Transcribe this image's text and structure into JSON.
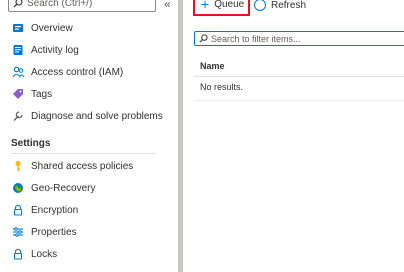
{
  "sidebar": {
    "search_placeholder": "Search (Ctrl+/)",
    "collapse_glyph": "«",
    "items": [
      {
        "label": "Overview",
        "icon": "overview-icon"
      },
      {
        "label": "Activity log",
        "icon": "activity-log-icon"
      },
      {
        "label": "Access control (IAM)",
        "icon": "people-icon"
      },
      {
        "label": "Tags",
        "icon": "tag-icon"
      },
      {
        "label": "Diagnose and solve problems",
        "icon": "wrench-icon"
      }
    ],
    "settings_header": "Settings",
    "settings_items": [
      {
        "label": "Shared access policies",
        "icon": "key-icon"
      },
      {
        "label": "Geo-Recovery",
        "icon": "globe-icon"
      },
      {
        "label": "Encryption",
        "icon": "lock-icon"
      },
      {
        "label": "Properties",
        "icon": "properties-icon"
      },
      {
        "label": "Locks",
        "icon": "lock-icon"
      }
    ]
  },
  "toolbar": {
    "queue_label": "Queue",
    "refresh_label": "Refresh"
  },
  "filter": {
    "placeholder": "Search to filter items..."
  },
  "table": {
    "columns": [
      "Name"
    ],
    "empty_text": "No results."
  },
  "colors": {
    "accent": "#0078d4",
    "highlight_border": "#e81123"
  }
}
